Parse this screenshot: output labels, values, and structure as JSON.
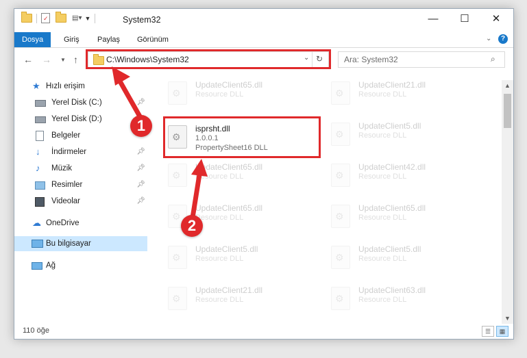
{
  "titlebar": {
    "title": "System32",
    "minimize": "—",
    "maximize": "☐",
    "close": "✕"
  },
  "ribbon": {
    "tabs": [
      "Dosya",
      "Giriş",
      "Paylaş",
      "Görünüm"
    ]
  },
  "address": {
    "path": "C:\\Windows\\System32",
    "search_placeholder": "Ara: System32"
  },
  "sidebar": {
    "items": [
      {
        "label": "Hızlı erişim",
        "icon": "star-icon"
      },
      {
        "label": "Yerel Disk (C:)",
        "icon": "drive-icon",
        "pinned": true
      },
      {
        "label": "Yerel Disk (D:)",
        "icon": "drive-icon"
      },
      {
        "label": "Belgeler",
        "icon": "document-icon"
      },
      {
        "label": "İndirmeler",
        "icon": "download-icon",
        "pinned": true
      },
      {
        "label": "Müzik",
        "icon": "music-icon",
        "pinned": true
      },
      {
        "label": "Resimler",
        "icon": "pictures-icon",
        "pinned": true
      },
      {
        "label": "Videolar",
        "icon": "video-icon",
        "pinned": true
      },
      {
        "label": "OneDrive",
        "icon": "cloud-icon"
      },
      {
        "label": "Bu bilgisayar",
        "icon": "computer-icon",
        "selected": true
      },
      {
        "label": "Ağ",
        "icon": "network-icon"
      }
    ]
  },
  "files": {
    "highlighted": {
      "name": "isprsht.dll",
      "version": "1.0.0.1",
      "description": "PropertySheet16 DLL"
    },
    "left_column": [
      {
        "name": "UpdateClient65.dll",
        "type": "Resource DLL"
      },
      {
        "name": "UpdateClient65.dll",
        "type": "Resource DLL"
      },
      {
        "name": "UpdateClient65.dll",
        "type": "Resource DLL"
      },
      {
        "name": "UpdateClient5.dll",
        "type": "Resource DLL"
      },
      {
        "name": "UpdateClient21.dll",
        "type": "Resource DLL"
      }
    ],
    "right_column": [
      {
        "name": "UpdateClient21.dll",
        "type": "Resource DLL"
      },
      {
        "name": "UpdateClient5.dll",
        "type": "Resource DLL"
      },
      {
        "name": "UpdateClient42.dll",
        "type": "Resource DLL"
      },
      {
        "name": "UpdateClient65.dll",
        "type": "Resource DLL"
      },
      {
        "name": "UpdateClient5.dll",
        "type": "Resource DLL"
      },
      {
        "name": "UpdateClient63.dll",
        "type": "Resource DLL"
      }
    ]
  },
  "status": {
    "item_count": "110 öğe"
  },
  "callouts": [
    "1",
    "2"
  ],
  "colors": {
    "accent": "#1979ca",
    "highlight": "#e0292b",
    "selection": "#cce8ff"
  }
}
